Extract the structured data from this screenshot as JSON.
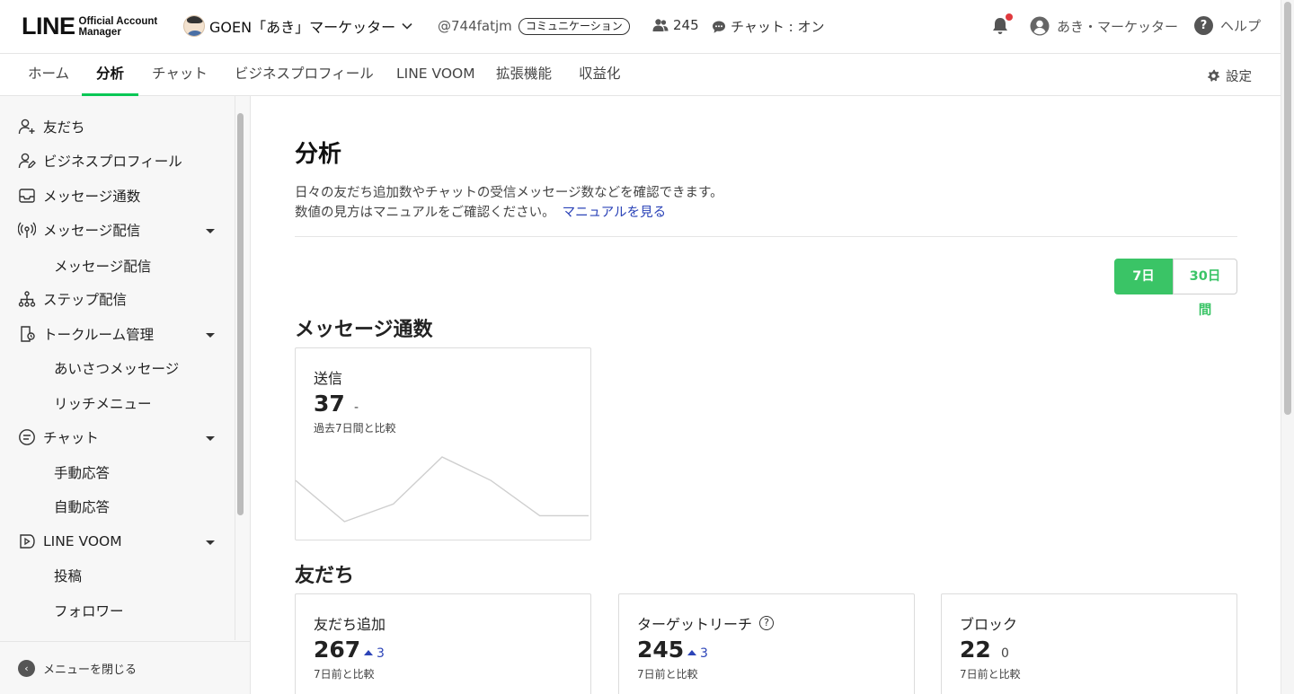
{
  "header": {
    "logo_main": "LINE",
    "logo_sub_1": "Official Account",
    "logo_sub_2": "Manager",
    "account_name": "GOEN「あき」マーケッター",
    "account_id": "@744fatjm",
    "plan_badge": "コミュニケーション",
    "friend_count": "245",
    "chat_status": "チャット : オン",
    "user_name": "あき・マーケッター",
    "help_label": "ヘルプ",
    "notification_dot_color": "#e0393e"
  },
  "tabs": [
    {
      "label": "ホーム",
      "active": false
    },
    {
      "label": "分析",
      "active": true
    },
    {
      "label": "チャット",
      "active": false
    },
    {
      "label": "ビジネスプロフィール",
      "active": false
    },
    {
      "label": "LINE VOOM",
      "active": false
    },
    {
      "label": "拡張機能",
      "active": false
    },
    {
      "label": "収益化",
      "active": false
    }
  ],
  "settings_label": "設定",
  "sidebar": {
    "items": [
      {
        "label": "友だち",
        "icon": "add-friend-icon"
      },
      {
        "label": "ビジネスプロフィール",
        "icon": "profile-icon"
      },
      {
        "label": "メッセージ通数",
        "icon": "inbox-icon"
      },
      {
        "label": "メッセージ配信",
        "icon": "broadcast-icon",
        "expanded": true
      },
      {
        "label": "メッセージ配信",
        "sub": true
      },
      {
        "label": "ステップ配信",
        "icon": "hierarchy-icon"
      },
      {
        "label": "トークルーム管理",
        "icon": "room-icon",
        "expanded": true
      },
      {
        "label": "あいさつメッセージ",
        "sub": true
      },
      {
        "label": "リッチメニュー",
        "sub": true
      },
      {
        "label": "チャット",
        "icon": "chat-bubble-icon",
        "expanded": true
      },
      {
        "label": "手動応答",
        "sub": true
      },
      {
        "label": "自動応答",
        "sub": true
      },
      {
        "label": "LINE VOOM",
        "icon": "voom-icon",
        "expanded": true
      },
      {
        "label": "投稿",
        "sub": true
      },
      {
        "label": "フォロワー",
        "sub": true
      }
    ],
    "close_menu_label": "メニューを閉じる"
  },
  "main": {
    "title": "分析",
    "desc_line1": "日々の友だち追加数やチャットの受信メッセージ数などを確認できます。",
    "desc_line2": "数値の見方はマニュアルをご確認ください。",
    "manual_link": "マニュアルを見る",
    "period_7": "7日間",
    "period_30": "30日間",
    "accent_color": "#3ac466",
    "section_messages": "メッセージ通数",
    "section_friends": "友だち",
    "cards": {
      "sent": {
        "label": "送信",
        "value": "37",
        "diff": "-",
        "note": "過去7日間と比較"
      },
      "friend_add": {
        "label": "友だち追加",
        "value": "267",
        "diff": "3",
        "note": "7日前と比較"
      },
      "target_reach": {
        "label": "ターゲットリーチ",
        "value": "245",
        "diff": "3",
        "note": "7日前と比較"
      },
      "block": {
        "label": "ブロック",
        "value": "22",
        "diff": "0",
        "note": "7日前と比較"
      }
    }
  },
  "chart_data": {
    "type": "line",
    "title": "",
    "xlabel": "",
    "ylabel": "",
    "values": [
      10,
      3,
      6,
      14,
      10,
      4,
      4
    ]
  }
}
